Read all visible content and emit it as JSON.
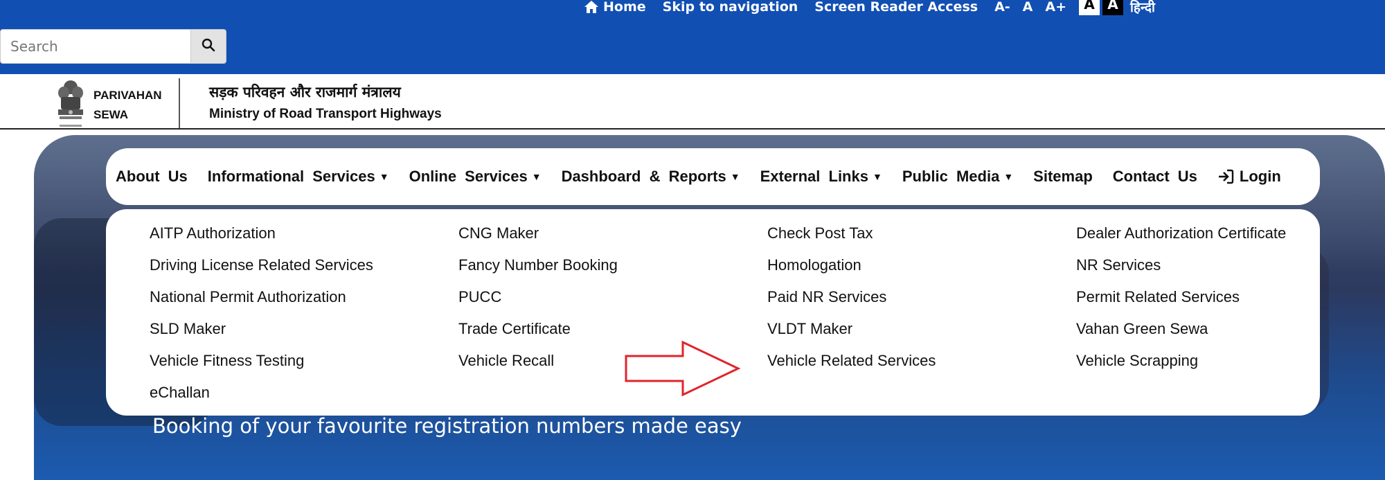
{
  "utility": {
    "home": "Home",
    "skip": "Skip to navigation",
    "screen_reader": "Screen Reader Access",
    "font_decrease": "A-",
    "font_normal": "A",
    "font_increase": "A+",
    "theme_light": "A",
    "theme_dark": "A",
    "language": "हिन्दी"
  },
  "search": {
    "placeholder": "Search"
  },
  "brand": {
    "line1": "PARIVAHAN",
    "line2": "SEWA"
  },
  "ministry": {
    "hindi": "सड़क परिवहन और राजमार्ग मंत्रालय",
    "english": "Ministry of Road Transport Highways"
  },
  "nav": {
    "about": "About Us",
    "informational": "Informational Services",
    "online": "Online Services",
    "dashboard": "Dashboard & Reports",
    "external": "External Links",
    "public_media": "Public Media",
    "sitemap": "Sitemap",
    "contact": "Contact Us",
    "login": "Login"
  },
  "dropdown": {
    "items": [
      "AITP Authorization",
      "CNG Maker",
      "Check Post Tax",
      "Dealer Authorization Certificate",
      "Driving License Related Services",
      "Fancy Number Booking",
      "Homologation",
      "NR Services",
      "National Permit Authorization",
      "PUCC",
      "Paid NR Services",
      "Permit Related Services",
      "SLD Maker",
      "Trade Certificate",
      "VLDT Maker",
      "Vahan Green Sewa",
      "Vehicle Fitness Testing",
      "Vehicle Recall",
      "Vehicle Related Services",
      "Vehicle Scrapping",
      "eChallan"
    ]
  },
  "hero": {
    "caption": "Booking of your favourite registration numbers made easy"
  },
  "colors": {
    "topbar": "#124fb3",
    "annotation_arrow": "#e0242b"
  }
}
